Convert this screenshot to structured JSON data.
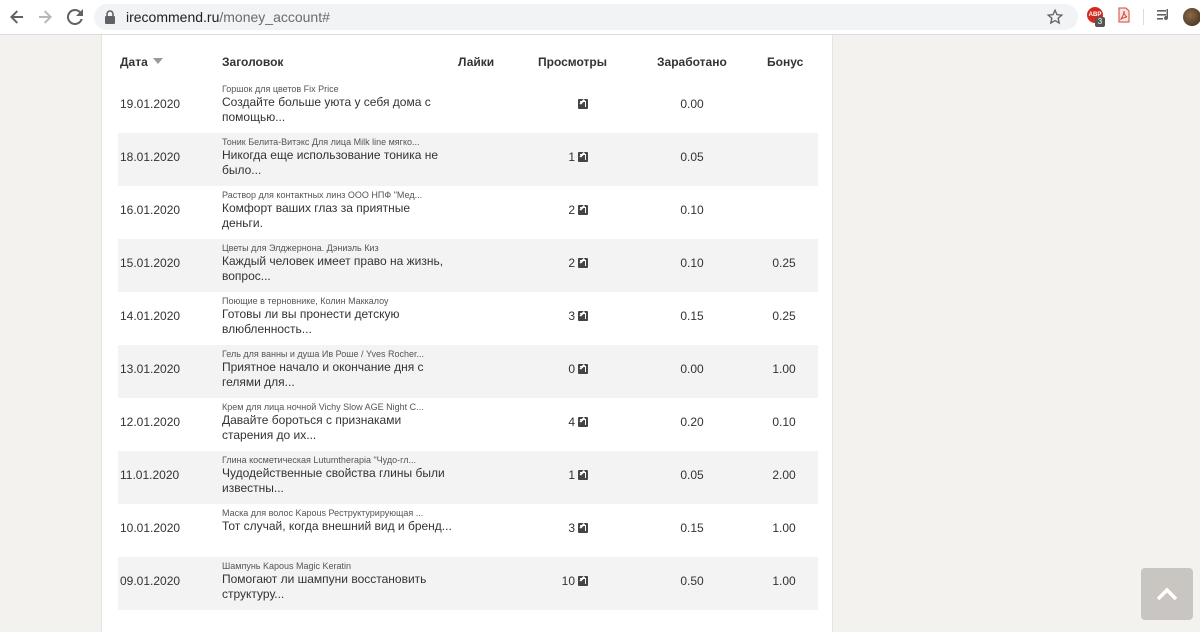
{
  "browser": {
    "url_host": "irecommend.ru",
    "url_path": "/money_account#",
    "ext_badge_count": "3"
  },
  "table": {
    "headers": {
      "date": "Дата",
      "title": "Заголовок",
      "likes": "Лайки",
      "views": "Просмотры",
      "earned": "Заработано",
      "bonus": "Бонус"
    },
    "rows": [
      {
        "date": "19.01.2020",
        "product": "Горшок для цветов Fix Price",
        "title": "Создайте больше уюта у себя дома с помощью...",
        "likes": "",
        "views": "",
        "earned": "0.00",
        "bonus": ""
      },
      {
        "date": "18.01.2020",
        "product": "Тоник Белита-Витэкс Для лица Milk line мягко...",
        "title": "Никогда еще использование тоника не было...",
        "likes": "",
        "views": "1",
        "earned": "0.05",
        "bonus": ""
      },
      {
        "date": "16.01.2020",
        "product": "Раствор для контактных линз ООО НПФ \"Мед...",
        "title": "Комфорт ваших глаз за приятные деньги.",
        "likes": "",
        "views": "2",
        "earned": "0.10",
        "bonus": ""
      },
      {
        "date": "15.01.2020",
        "product": "Цветы для Элджернона. Дэниэль Киз",
        "title": "Каждый человек имеет право на жизнь, вопрос...",
        "likes": "",
        "views": "2",
        "earned": "0.10",
        "bonus": "0.25"
      },
      {
        "date": "14.01.2020",
        "product": "Поющие в терновнике, Колин Маккалоу",
        "title": "Готовы ли вы пронести детскую влюбленность...",
        "likes": "",
        "views": "3",
        "earned": "0.15",
        "bonus": "0.25"
      },
      {
        "date": "13.01.2020",
        "product": "Гель для ванны и душа Ив Роше / Yves Rocher...",
        "title": "Приятное начало и окончание дня с гелями для...",
        "likes": "",
        "views": "0",
        "earned": "0.00",
        "bonus": "1.00"
      },
      {
        "date": "12.01.2020",
        "product": "Крем для лица ночной Vichy Slow AGE Night C...",
        "title": "Давайте бороться с признаками старения до их...",
        "likes": "",
        "views": "4",
        "earned": "0.20",
        "bonus": "0.10"
      },
      {
        "date": "11.01.2020",
        "product": "Глина косметическая Lutumtherapia \"Чудо-гл...",
        "title": "Чудодейственные свойства глины были известны...",
        "likes": "",
        "views": "1",
        "earned": "0.05",
        "bonus": "2.00"
      },
      {
        "date": "10.01.2020",
        "product": "Маска для волос Kapous Реструктурирующая ...",
        "title": "Тот случай, когда внешний вид и бренд...",
        "likes": "",
        "views": "3",
        "earned": "0.15",
        "bonus": "1.00"
      },
      {
        "date": "09.01.2020",
        "product": "Шампунь Kapous Magic Keratin",
        "title": "Помогают ли шампуни восстановить структуру...",
        "likes": "",
        "views": "10",
        "earned": "0.50",
        "bonus": "1.00"
      }
    ]
  }
}
